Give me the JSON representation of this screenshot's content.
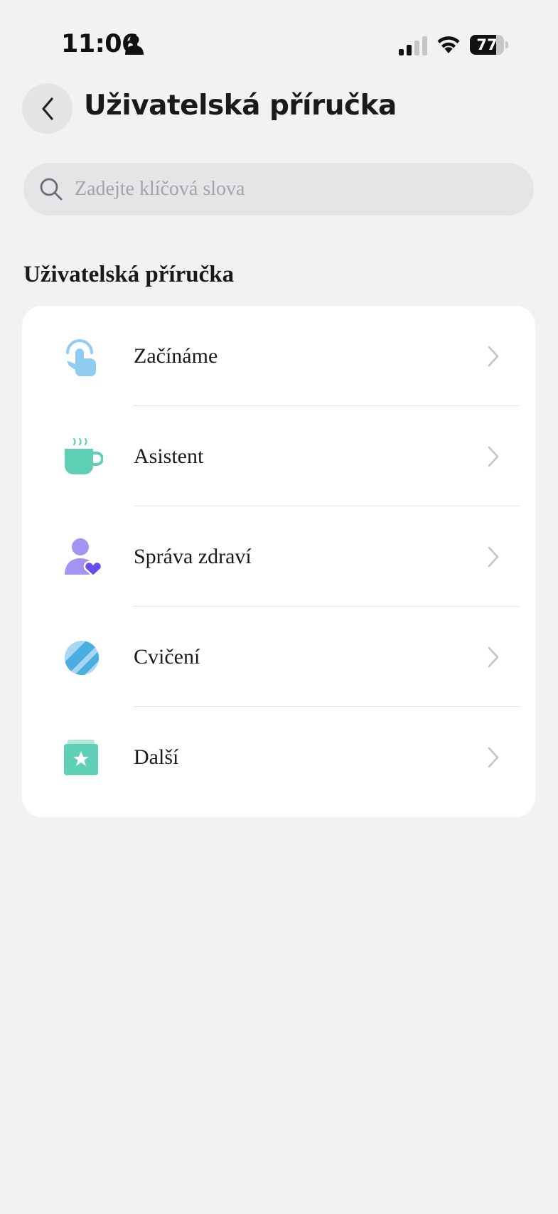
{
  "status_bar": {
    "time": "11:06",
    "battery": "77",
    "battery_level": 0.77
  },
  "header": {
    "title": "Uživatelská příručka",
    "back_icon": "chevron-left-icon"
  },
  "search": {
    "placeholder": "Zadejte klíčová slova",
    "icon": "search-icon"
  },
  "section": {
    "title": "Uživatelská příručka"
  },
  "menu_items": [
    {
      "label": "Začínáme",
      "icon": "pointer-tap-icon",
      "color": "#8ecdf0"
    },
    {
      "label": "Asistent",
      "icon": "coffee-cup-icon",
      "color": "#5fd0b6"
    },
    {
      "label": "Správa zdraví",
      "icon": "person-heart-icon",
      "color": "#a493f2"
    },
    {
      "label": "Cvičení",
      "icon": "tennis-ball-icon",
      "color": "#4aaee0"
    },
    {
      "label": "Další",
      "icon": "star-folder-icon",
      "color": "#5fd0b6"
    }
  ],
  "colors": {
    "background": "#f1f2f4",
    "card": "#ffffff",
    "chevron": "#c3c4c7"
  }
}
